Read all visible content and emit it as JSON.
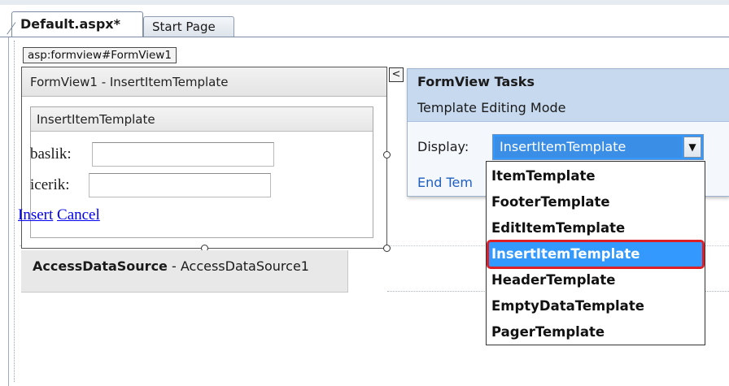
{
  "tabs": [
    {
      "label": "Default.aspx*",
      "active": true
    },
    {
      "label": "Start Page",
      "active": false
    }
  ],
  "control_tag": "asp:formview#FormView1",
  "formview": {
    "header": "FormView1 - InsertItemTemplate",
    "template_header": "InsertItemTemplate",
    "fields": [
      {
        "label": "baslik:",
        "value": ""
      },
      {
        "label": "icerik:",
        "value": ""
      }
    ],
    "links": {
      "insert": "Insert",
      "cancel": "Cancel"
    }
  },
  "datasource": {
    "type": "AccessDataSource",
    "separator": " - ",
    "name": "AccessDataSource1"
  },
  "smart_tag_glyph": "<",
  "tasks_panel": {
    "title": "FormView Tasks",
    "mode": "Template Editing Mode",
    "display_label": "Display:",
    "selected": "InsertItemTemplate",
    "dropdown_arrow": "▼",
    "end_link": "End Tem"
  },
  "dropdown_options": [
    "ItemTemplate",
    "FooterTemplate",
    "EditItemTemplate",
    "InsertItemTemplate",
    "HeaderTemplate",
    "EmptyDataTemplate",
    "PagerTemplate"
  ],
  "colors": {
    "selection": "#3399ff",
    "highlight_outline": "#dd1f26",
    "tasks_header": "#c7d9ef",
    "link": "#0000ee"
  }
}
